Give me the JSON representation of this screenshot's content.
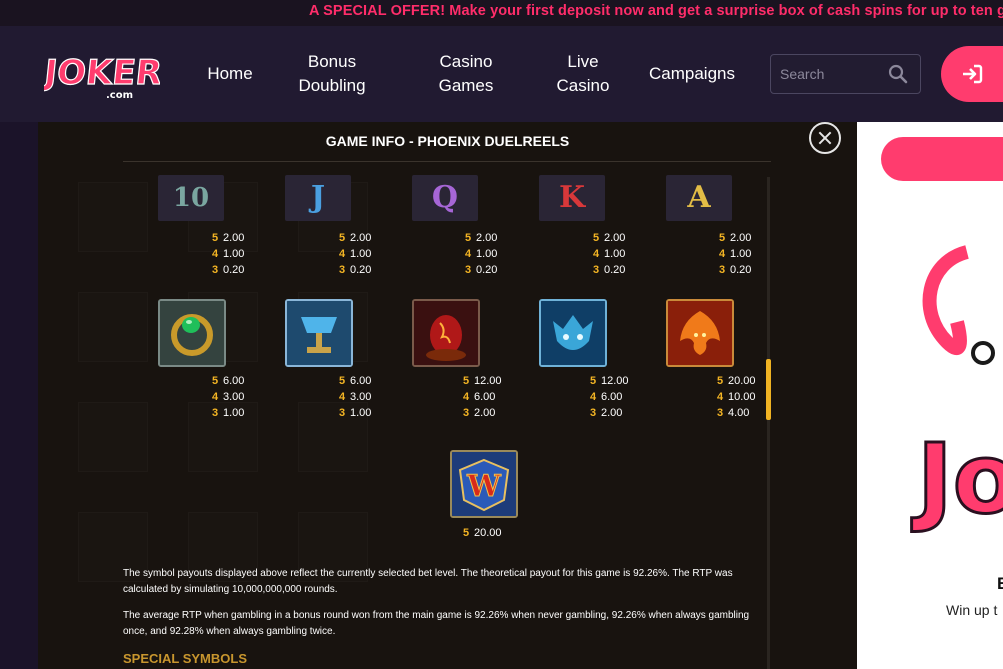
{
  "promo": {
    "text": "A SPECIAL OFFER! Make your first deposit now and get a surprise box of cash spins for up to ten gra"
  },
  "header": {
    "logo_text": "JOKERI",
    "logo_sub": ".com",
    "nav": [
      "Home",
      "Bonus Doubling",
      "Casino Games",
      "Live Casino",
      "Campaigns"
    ],
    "search_placeholder": "Search",
    "login_icon": "login-icon"
  },
  "modal": {
    "title": "GAME INFO - PHOENIX DUELREELS",
    "symbols_row1": [
      {
        "name": "10",
        "color": "#7aa6a0",
        "pays": [
          [
            "5",
            "2.00"
          ],
          [
            "4",
            "1.00"
          ],
          [
            "3",
            "0.20"
          ]
        ]
      },
      {
        "name": "J",
        "color": "#4a9fe0",
        "pays": [
          [
            "5",
            "2.00"
          ],
          [
            "4",
            "1.00"
          ],
          [
            "3",
            "0.20"
          ]
        ]
      },
      {
        "name": "Q",
        "color": "#a666d6",
        "pays": [
          [
            "5",
            "2.00"
          ],
          [
            "4",
            "1.00"
          ],
          [
            "3",
            "0.20"
          ]
        ]
      },
      {
        "name": "K",
        "color": "#d8383a",
        "pays": [
          [
            "5",
            "2.00"
          ],
          [
            "4",
            "1.00"
          ],
          [
            "3",
            "0.20"
          ]
        ]
      },
      {
        "name": "A",
        "color": "#e2bc46",
        "pays": [
          [
            "5",
            "2.00"
          ],
          [
            "4",
            "1.00"
          ],
          [
            "3",
            "0.20"
          ]
        ]
      }
    ],
    "symbols_row2": [
      {
        "icon": "emerald-ring-icon",
        "pays": [
          [
            "5",
            "6.00"
          ],
          [
            "4",
            "3.00"
          ],
          [
            "3",
            "1.00"
          ]
        ]
      },
      {
        "icon": "blue-chalice-icon",
        "pays": [
          [
            "5",
            "6.00"
          ],
          [
            "4",
            "3.00"
          ],
          [
            "3",
            "1.00"
          ]
        ]
      },
      {
        "icon": "fire-egg-icon",
        "pays": [
          [
            "5",
            "12.00"
          ],
          [
            "4",
            "6.00"
          ],
          [
            "3",
            "2.00"
          ]
        ]
      },
      {
        "icon": "blue-dragon-icon",
        "pays": [
          [
            "5",
            "12.00"
          ],
          [
            "4",
            "6.00"
          ],
          [
            "3",
            "2.00"
          ]
        ]
      },
      {
        "icon": "phoenix-icon",
        "pays": [
          [
            "5",
            "20.00"
          ],
          [
            "4",
            "10.00"
          ],
          [
            "3",
            "4.00"
          ]
        ]
      }
    ],
    "wild": {
      "icon": "wild-icon",
      "letter": "W",
      "pays": [
        [
          "5",
          "20.00"
        ]
      ]
    },
    "para1": "The symbol payouts displayed above reflect the currently selected bet level. The theoretical payout for this game is 92.26%. The RTP was calculated by simulating 10,000,000,000 rounds.",
    "para2": "The average RTP when gambling in a bonus round won from the main game is 92.26% when never gambling, 92.26% when always gambling once, and 92.28% when always gambling twice.",
    "special_heading": "SPECIAL SYMBOLS"
  },
  "sidebar": {
    "heading_fragment": "E",
    "text_fragment": "Win up t"
  },
  "colors": {
    "accent": "#ff3c6e",
    "gold": "#f4b524",
    "header_bg": "#211a31"
  }
}
